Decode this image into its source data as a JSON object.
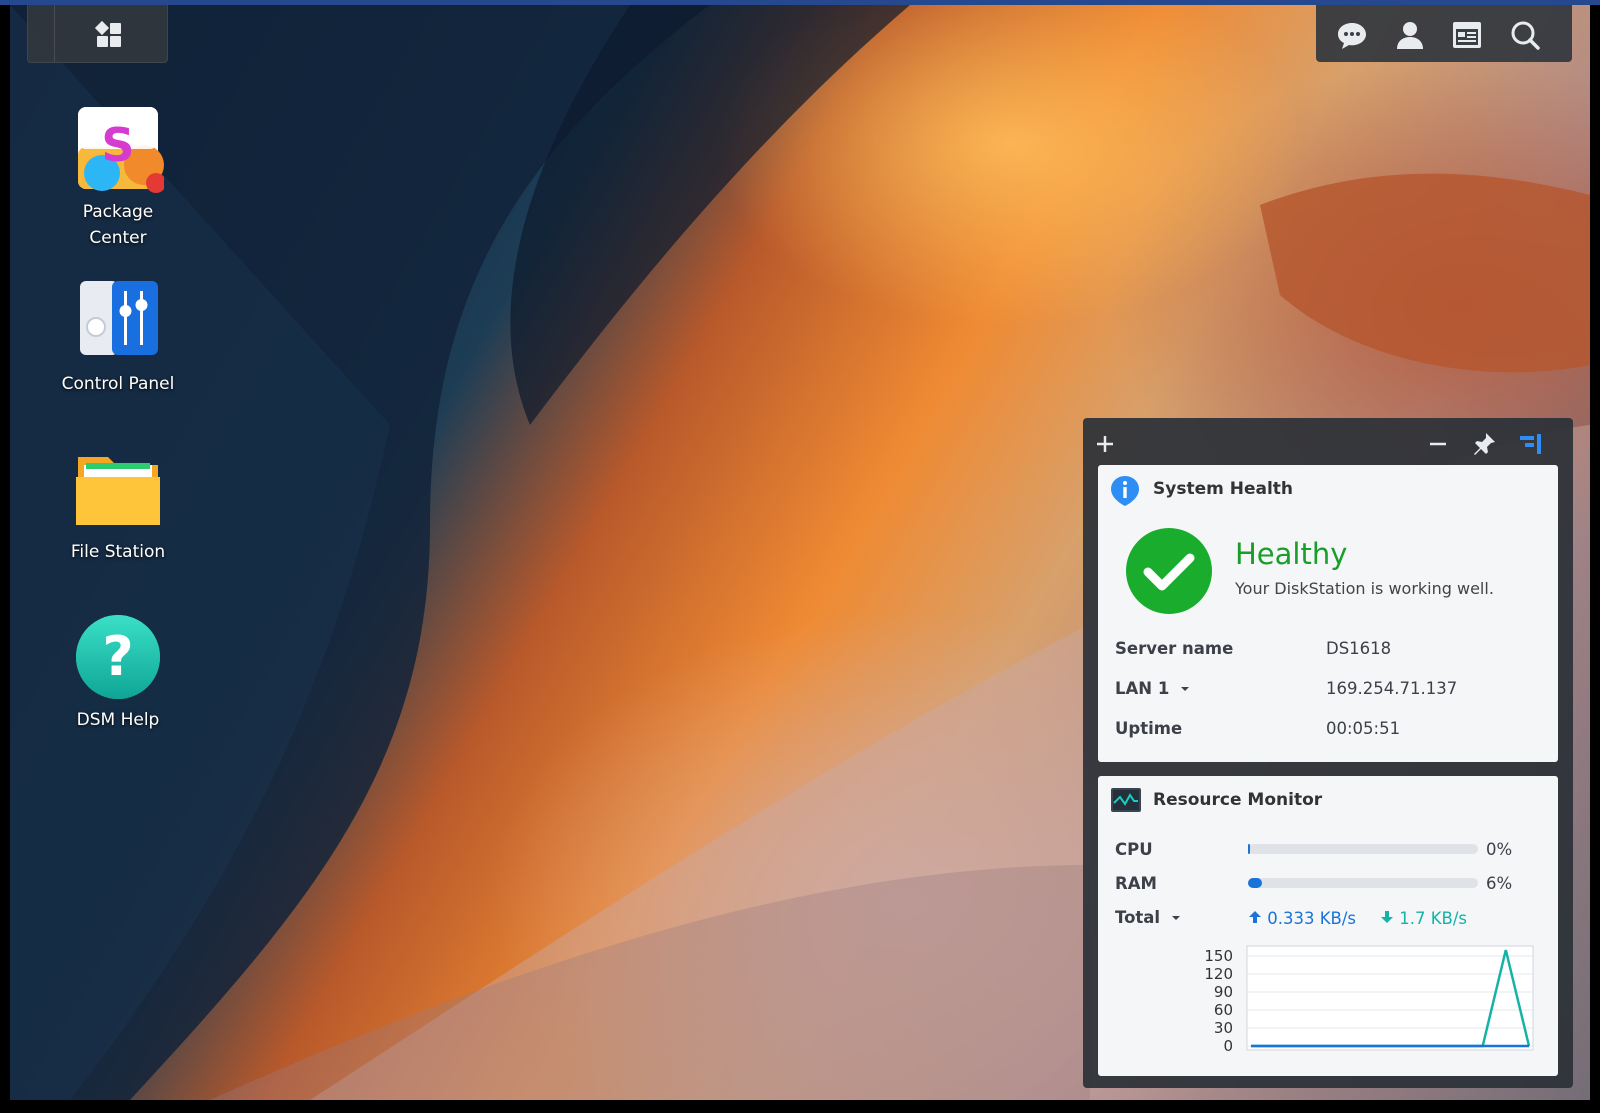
{
  "desktop": {
    "icons": [
      {
        "label": "Package\nCenter",
        "label_line1": "Package",
        "label_line2": "Center",
        "icon": "package-center-icon",
        "has_badge": true
      },
      {
        "label": "Control Panel",
        "icon": "control-panel-icon"
      },
      {
        "label": "File Station",
        "icon": "folder-icon"
      },
      {
        "label": "DSM Help",
        "icon": "help-icon"
      }
    ]
  },
  "taskbar": {
    "left": {
      "main_menu_icon": "grid-icon"
    },
    "right": {
      "icons": [
        "chat-icon",
        "user-icon",
        "widgets-icon",
        "search-icon"
      ]
    }
  },
  "widget_panel": {
    "controls": {
      "add": "plus-icon",
      "minimize": "minus-icon",
      "pin": "pin-icon",
      "layout": "widget-layout-icon"
    },
    "system_health": {
      "title": "System Health",
      "status": "Healthy",
      "description": "Your DiskStation is working well.",
      "rows": [
        {
          "label": "Server name",
          "value": "DS1618"
        },
        {
          "label": "LAN 1",
          "value": "169.254.71.137",
          "dropdown": true
        },
        {
          "label": "Uptime",
          "value": "00:05:51"
        }
      ]
    },
    "resource_monitor": {
      "title": "Resource Monitor",
      "cpu": {
        "label": "CPU",
        "value": "0%",
        "fraction": 0.0
      },
      "ram": {
        "label": "RAM",
        "value": "6%",
        "fraction": 0.06
      },
      "network": {
        "label": "Total",
        "upload": "0.333 KB/s",
        "download": "1.7 KB/s"
      },
      "chart": {
        "yticks": [
          "150",
          "120",
          "90",
          "60",
          "30",
          "0"
        ],
        "ymax": 160,
        "upload_series": [
          0,
          0,
          0,
          0,
          0,
          0,
          0,
          0,
          0,
          0,
          0,
          0,
          0
        ],
        "download_series": [
          0,
          0,
          0,
          0,
          0,
          0,
          0,
          0,
          0,
          0,
          0,
          160,
          0
        ],
        "colors": {
          "upload": "#1a73d9",
          "download": "#15b3a6"
        }
      }
    }
  },
  "colors": {
    "accent": "#1a73d9",
    "healthy": "#1a9e2a",
    "teal": "#15b3a6"
  }
}
